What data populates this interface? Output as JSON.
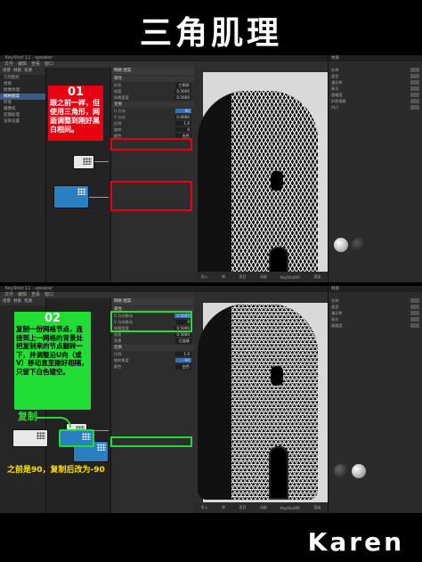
{
  "page_title": "三角肌理",
  "signature": "Karen",
  "steps": [
    {
      "number": "01",
      "text": "跟之前一样，但使用三角形，网面调整到刚好黑白相间。"
    },
    {
      "number": "02",
      "text": "复制一份网格节点，连接到上一网格的背景处把复制来的节点翻转一下，并调整沿U向（或V）移动直至刚好相隔，只留下白色镂空。"
    }
  ],
  "annotations": {
    "copy_label": "复制",
    "angle_change": "之前是90，复制后改为-90"
  },
  "top_shot": {
    "tree": {
      "tabs": [
        "场景",
        "材质",
        "资源"
      ],
      "items": [
        "几何图形",
        "材质",
        "图像纹理",
        "网格图案",
        "环境",
        "摄像机",
        "后期处理",
        "渲染设置"
      ],
      "selected_index": 3
    },
    "props": {
      "header": "网格 图案",
      "rows": [
        {
          "label": "形状",
          "value": "三角形"
        },
        {
          "label": "线宽",
          "value": "0.5000"
        },
        {
          "label": "网格宽度",
          "value": "0.5000"
        },
        {
          "label": "U 方向",
          "value": "90"
        },
        {
          "label": "V 方向",
          "value": "0.0000"
        },
        {
          "label": "比例",
          "value": "1.0"
        },
        {
          "label": "旋转",
          "value": "0"
        },
        {
          "label": "颜色",
          "value": "白色"
        }
      ],
      "highlight_rows": [
        0,
        1,
        4
      ]
    }
  },
  "bottom_shot": {
    "props": {
      "header": "网格 图案",
      "rows": [
        {
          "label": "U 方向移动",
          "value": "0.5000"
        },
        {
          "label": "V 方向移动",
          "value": "0"
        },
        {
          "label": "网格宽度",
          "value": "0.5000"
        },
        {
          "label": "线宽",
          "value": "0.5000"
        },
        {
          "label": "背景",
          "value": "已连接"
        },
        {
          "label": "比例",
          "value": "1.0"
        },
        {
          "label": "旋转角度",
          "value": "-90"
        },
        {
          "label": "颜色",
          "value": "白色"
        }
      ],
      "highlight_rows": [
        0,
        1,
        6
      ]
    }
  },
  "viewport": {
    "title": "KeyShot 11 - speaker",
    "bottom_buttons": [
      "导入",
      "库",
      "项目",
      "动画",
      "KeyShotXR",
      "渲染"
    ]
  },
  "material_panel": {
    "header": "材质",
    "rows": [
      "名称",
      "类型",
      "漫反射",
      "高光",
      "粗糙度",
      "折射指数",
      "凹凸"
    ],
    "swatch_labels": [
      "塑料",
      "网格"
    ]
  },
  "colors": {
    "red": "#e60012",
    "green": "#22dd33",
    "yellow": "#ffe000",
    "node_blue": "#2a7fc0"
  }
}
